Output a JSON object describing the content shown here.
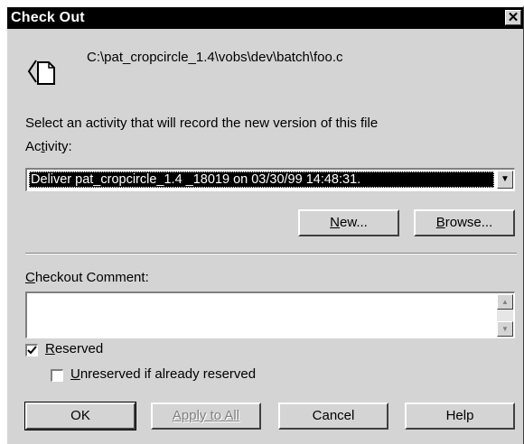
{
  "window": {
    "title": "Check Out",
    "close_glyph": "✕"
  },
  "file": {
    "path": "C:\\pat_cropcircle_1.4\\vobs\\dev\\batch\\foo.c",
    "icon": "checkout-file-icon"
  },
  "activity": {
    "prompt": "Select an activity that will record the new version of this file",
    "label_pre": "Ac",
    "label_key": "t",
    "label_post": "ivity:",
    "selected": "Deliver  pat_cropcircle_1.4 _18019 on 03/30/99 14:48:31."
  },
  "buttons": {
    "new_key": "N",
    "new_rest": "ew...",
    "browse_key": "B",
    "browse_rest": "rowse...",
    "ok": "OK",
    "apply_all": "Apply to All",
    "cancel": "Cancel",
    "help": "Help"
  },
  "comment": {
    "label_key": "C",
    "label_rest": "heckout Comment:",
    "value": ""
  },
  "options": {
    "reserved_key": "R",
    "reserved_rest": "eserved",
    "reserved_checked": true,
    "unreserved_key": "U",
    "unreserved_rest": "nreserved if already reserved",
    "unreserved_checked": false
  }
}
